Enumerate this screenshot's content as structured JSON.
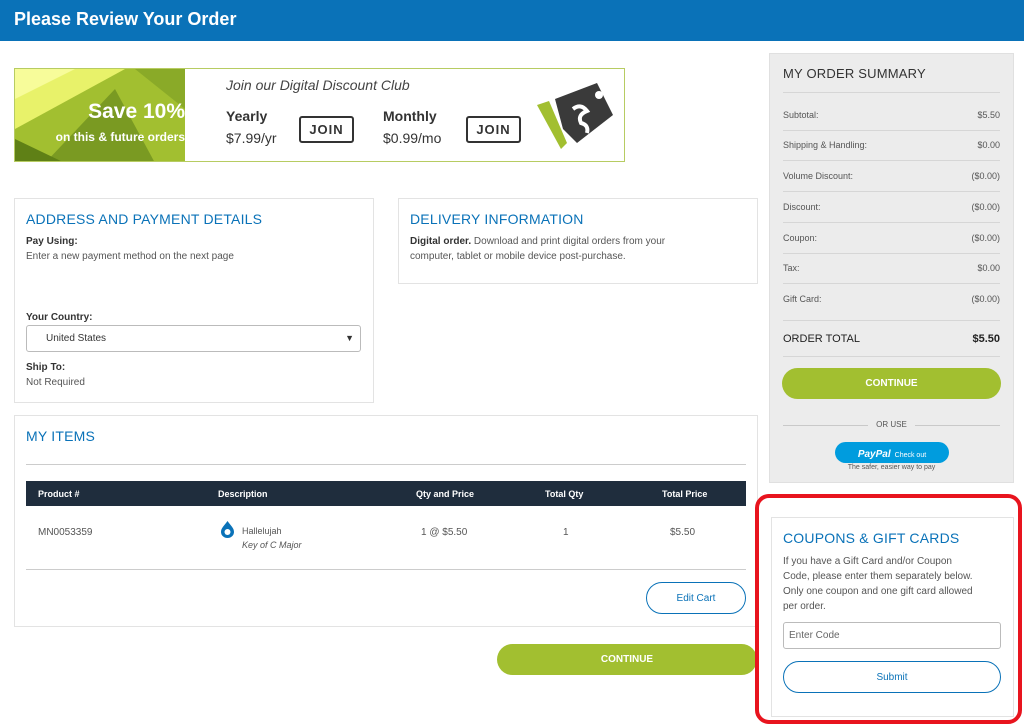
{
  "header": {
    "title": "Please Review Your Order"
  },
  "promo": {
    "save_big": "Save 10%",
    "save_small": "on this & future orders",
    "join_title": "Join our Digital Discount Club",
    "yearly_label": "Yearly",
    "yearly_price": "$7.99/yr",
    "monthly_label": "Monthly",
    "monthly_price": "$0.99/mo",
    "join_label": "JOIN",
    "icon": "price-tag-icon",
    "accent_color": "#a2bf30"
  },
  "address": {
    "title": "ADDRESS AND PAYMENT DETAILS",
    "pay_using_label": "Pay Using:",
    "pay_using_text": "Enter a new payment method on the next page",
    "country_label": "Your Country:",
    "country_value": "United States",
    "ship_to_label": "Ship To:",
    "ship_to_value": "Not Required"
  },
  "delivery": {
    "title": "DELIVERY INFORMATION",
    "bold": "Digital order.",
    "line1": "Download and print digital orders from your",
    "line2": "computer, tablet or mobile device post-purchase."
  },
  "items": {
    "title": "MY ITEMS",
    "columns": [
      "Product #",
      "Description",
      "Qty and Price",
      "Total Qty",
      "Total Price"
    ],
    "rows": [
      {
        "product": "MN0053359",
        "name": "Hallelujah",
        "key": "Key of C Major",
        "qty_price": "1 @ $5.50",
        "total_qty": "1",
        "total_price": "$5.50",
        "icon": "digital-sheet-music-icon"
      }
    ],
    "edit_label": "Edit Cart"
  },
  "continue_label": "CONTINUE",
  "summary": {
    "title": "MY ORDER SUMMARY",
    "lines": [
      {
        "label": "Subtotal:",
        "value": "$5.50"
      },
      {
        "label": "Shipping & Handling:",
        "value": "$0.00"
      },
      {
        "label": "Volume Discount:",
        "value": "($0.00)"
      },
      {
        "label": "Discount:",
        "value": "($0.00)"
      },
      {
        "label": "Coupon:",
        "value": "($0.00)"
      },
      {
        "label": "Tax:",
        "value": "$0.00"
      },
      {
        "label": "Gift Card:",
        "value": "($0.00)"
      }
    ],
    "total_label": "ORDER TOTAL",
    "total_value": "$5.50",
    "or_use": "OR USE",
    "paypal_label": "PayPal",
    "paypal_checkout": "Check out",
    "paypal_tagline": "The safer, easier way to pay"
  },
  "coupons": {
    "title": "COUPONS & GIFT CARDS",
    "line1": "If you have a Gift Card and/or Coupon",
    "line2": "Code, please enter them separately below.",
    "line3": "Only one coupon and one gift card allowed",
    "line4": "per order.",
    "placeholder": "Enter Code",
    "submit_label": "Submit",
    "highlight_color": "#e8141e"
  }
}
